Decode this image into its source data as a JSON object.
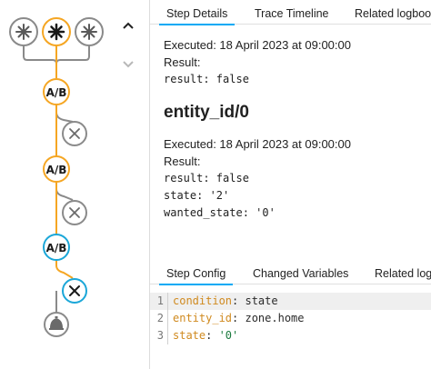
{
  "colors": {
    "active_path": "#f5a623",
    "current_node": "#1ba7d8",
    "inactive": "#8a8a8a",
    "tab_indicator": "#03a9f4",
    "yaml_key": "#d08a1f"
  },
  "graph": {
    "nodes": [
      {
        "name": "trigger-node-1",
        "icon": "asterisk-icon",
        "state": "inactive"
      },
      {
        "name": "trigger-node-2",
        "icon": "asterisk-icon",
        "state": "active"
      },
      {
        "name": "trigger-node-3",
        "icon": "asterisk-icon",
        "state": "inactive"
      },
      {
        "name": "condition-node-1",
        "icon": "ab-icon",
        "label": "A/B",
        "state": "active"
      },
      {
        "name": "condition-fail-node-1",
        "icon": "x-icon",
        "state": "inactive"
      },
      {
        "name": "condition-node-2",
        "icon": "ab-icon",
        "label": "A/B",
        "state": "active"
      },
      {
        "name": "condition-fail-node-2",
        "icon": "x-icon",
        "state": "inactive"
      },
      {
        "name": "condition-node-3",
        "icon": "ab-icon",
        "label": "A/B",
        "state": "current"
      },
      {
        "name": "condition-fail-node-3",
        "icon": "x-icon",
        "state": "current"
      },
      {
        "name": "action-node",
        "icon": "bell-icon",
        "state": "inactive"
      }
    ],
    "nav_up_icon": "chevron-up-icon",
    "nav_down_icon": "chevron-down-icon"
  },
  "tabs_top": [
    {
      "label": "Step Details",
      "active": true
    },
    {
      "label": "Trace Timeline",
      "active": false
    },
    {
      "label": "Related logbook",
      "active": false
    }
  ],
  "details": {
    "executed_1": "Executed: 18 April 2023 at 09:00:00",
    "result_label_1": "Result:",
    "result_value_1": "result: false",
    "heading": "entity_id/0",
    "executed_2": "Executed: 18 April 2023 at 09:00:00",
    "result_label_2": "Result:",
    "result_value_2": "result: false",
    "state_line": "state: '2'",
    "wanted_state_line": "wanted_state: '0'"
  },
  "tabs_bottom": [
    {
      "label": "Step Config",
      "active": true
    },
    {
      "label": "Changed Variables",
      "active": false
    },
    {
      "label": "Related logbook",
      "active": false
    }
  ],
  "config": [
    {
      "line": "1",
      "key": "condition",
      "sep": ": ",
      "value": "state"
    },
    {
      "line": "2",
      "key": "entity_id",
      "sep": ": ",
      "value": "zone.home"
    },
    {
      "line": "3",
      "key": "state",
      "sep": ": ",
      "value": "'0'"
    }
  ]
}
